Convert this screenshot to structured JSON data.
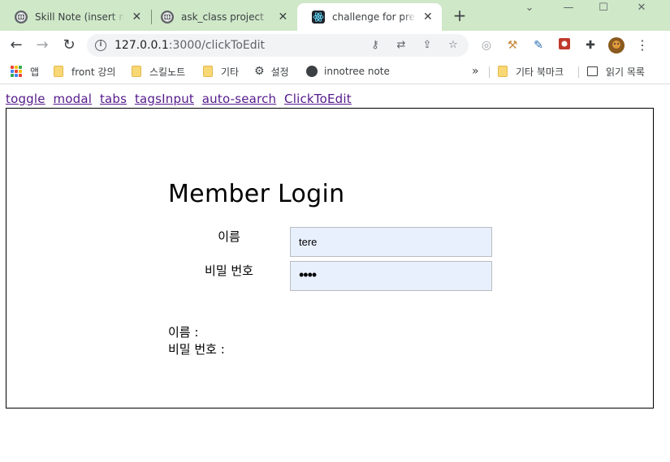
{
  "browser": {
    "tabs": [
      {
        "title": "Skill Note (insert mode)",
        "icon": "globe-icon",
        "active": false
      },
      {
        "title": "ask_class project",
        "icon": "globe-icon",
        "active": false
      },
      {
        "title": "challenge for pre-onboarding",
        "icon": "react-icon",
        "active": true
      }
    ],
    "close_glyph": "✕",
    "new_tab_glyph": "+",
    "window_controls": {
      "minimize": "—",
      "maximize": "☐",
      "close": "✕"
    },
    "url_host": "127.0.0.1",
    "url_rest": ":3000/clickToEdit",
    "bookmarks": [
      {
        "label": "앱",
        "icon": "apps-icon"
      },
      {
        "label": "front 강의",
        "icon": "folder-icon"
      },
      {
        "label": "스킬노트",
        "icon": "folder-icon"
      },
      {
        "label": "기타",
        "icon": "folder-icon"
      },
      {
        "label": "설정",
        "icon": "gear-icon"
      },
      {
        "label": "innotree note",
        "icon": "globe-icon"
      }
    ],
    "bookmarks_overflow": "»",
    "other_bookmarks": "기타 북마크",
    "reading_list": "읽기 목록"
  },
  "page": {
    "nav_links": [
      "toggle",
      "modal",
      "tabs",
      "tagsInput",
      "auto-search",
      "ClickToEdit"
    ],
    "title": "Member Login",
    "name_label": "이름",
    "name_value": "tere",
    "password_label": "비밀 번호",
    "password_mask": "••••",
    "output_name": "이름 :",
    "output_password": "비밀 번호 :"
  },
  "colors": {
    "tabstrip": "#cfe8c8",
    "input_bg": "#e8f0fe",
    "link": "#551a8b"
  }
}
